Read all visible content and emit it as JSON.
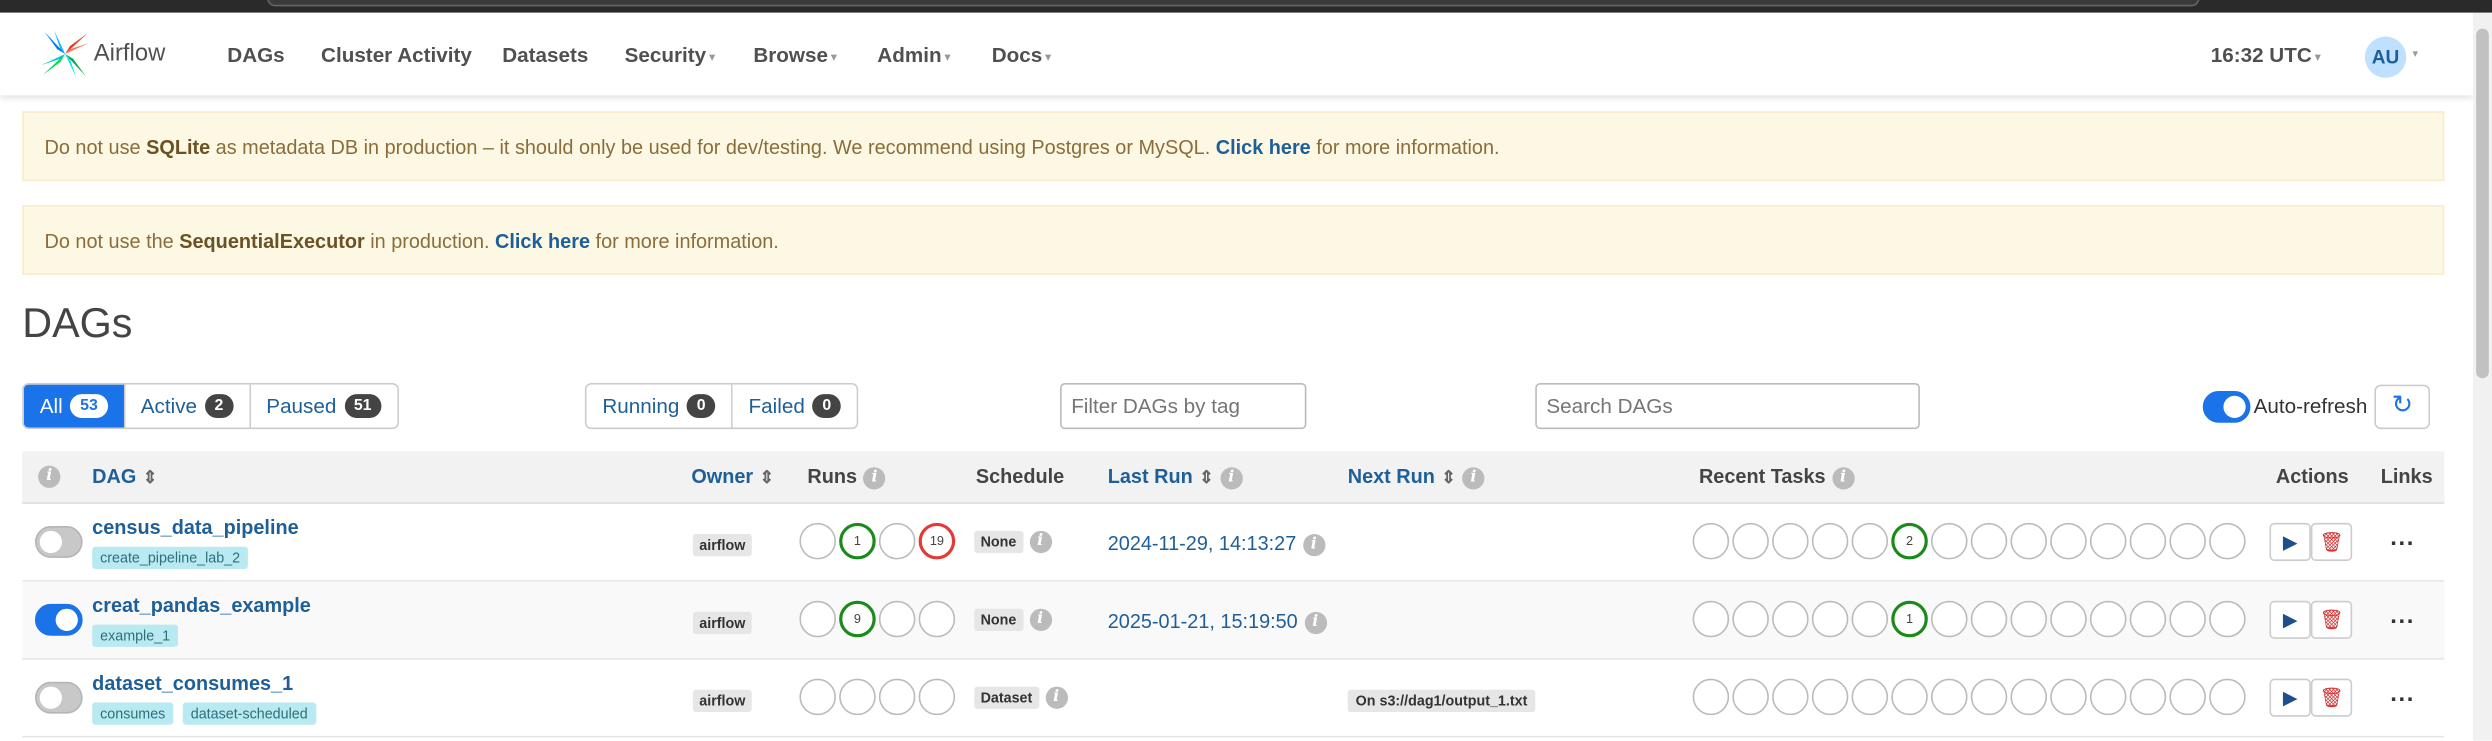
{
  "navbar": {
    "brand": "Airflow",
    "items": [
      {
        "label": "DAGs",
        "caret": false
      },
      {
        "label": "Cluster Activity",
        "caret": false
      },
      {
        "label": "Datasets",
        "caret": false
      },
      {
        "label": "Security",
        "caret": true
      },
      {
        "label": "Browse",
        "caret": true
      },
      {
        "label": "Admin",
        "caret": true
      },
      {
        "label": "Docs",
        "caret": true
      }
    ],
    "clock": "16:32 UTC",
    "avatar": "AU"
  },
  "alerts": [
    {
      "pre": "Do not use ",
      "strong": "SQLite",
      "mid": " as metadata DB in production – it should only be used for dev/testing. We recommend using Postgres or MySQL. ",
      "link": "Click here",
      "post": " for more information."
    },
    {
      "pre": "Do not use the ",
      "strong": "SequentialExecutor",
      "mid": " in production. ",
      "link": "Click here",
      "post": " for more information."
    }
  ],
  "page_title": "DAGs",
  "status_filters": [
    {
      "label": "All",
      "count": "53"
    },
    {
      "label": "Active",
      "count": "2"
    },
    {
      "label": "Paused",
      "count": "51"
    }
  ],
  "run_filters": [
    {
      "label": "Running",
      "count": "0"
    },
    {
      "label": "Failed",
      "count": "0"
    }
  ],
  "tag_filter_placeholder": "Filter DAGs by tag",
  "search_placeholder": "Search DAGs",
  "auto_refresh_label": "Auto-refresh",
  "table": {
    "headers": {
      "dag": "DAG",
      "owner": "Owner",
      "runs": "Runs",
      "schedule": "Schedule",
      "last_run": "Last Run",
      "next_run": "Next Run",
      "recent_tasks": "Recent Tasks",
      "actions": "Actions",
      "links": "Links"
    },
    "rows": [
      {
        "name": "census_data_pipeline",
        "active": false,
        "tags": [
          "create_pipeline_lab_2"
        ],
        "owner": "airflow",
        "runs": [
          "",
          "1",
          "",
          "19"
        ],
        "schedule": "None",
        "last_run": "2024-11-29, 14:13:27",
        "next_run": "",
        "recent_task_count": "2",
        "links": "..."
      },
      {
        "name": "creat_pandas_example",
        "active": true,
        "tags": [
          "example_1"
        ],
        "owner": "airflow",
        "runs": [
          "",
          "9",
          "",
          ""
        ],
        "schedule": "None",
        "last_run": "2025-01-21, 15:19:50",
        "next_run": "",
        "recent_task_count": "1",
        "links": "..."
      },
      {
        "name": "dataset_consumes_1",
        "active": false,
        "tags": [
          "consumes",
          "dataset-scheduled"
        ],
        "owner": "airflow",
        "runs": [
          "",
          "",
          "",
          ""
        ],
        "schedule": "Dataset",
        "last_run": "",
        "next_run": "On s3://dag1/output_1.txt",
        "recent_task_count": "",
        "links": "..."
      }
    ]
  },
  "colors": {
    "accent": "#1a73e8",
    "link": "#1e5f99",
    "success": "#1a8a1a",
    "failed": "#e53935",
    "alert_bg": "#fcf8e3",
    "tag_bg": "#b9eaf1"
  },
  "icons": [
    "airflow-logo",
    "info-icon",
    "sort-icon",
    "refresh-icon",
    "play-icon",
    "trash-icon"
  ]
}
